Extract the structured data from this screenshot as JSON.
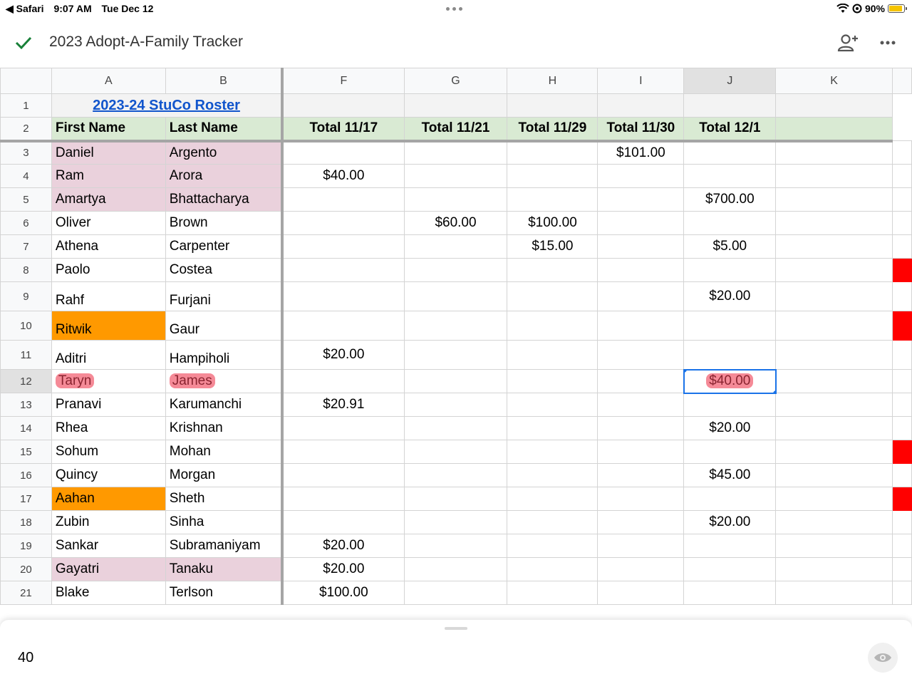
{
  "status_bar": {
    "back_app": "◀ Safari",
    "time": "9:07 AM",
    "date": "Tue Dec 12",
    "battery": "90%",
    "battery_level": 0.9
  },
  "header": {
    "title": "2023 Adopt-A-Family Tracker",
    "icons": [
      "check-icon",
      "add-person-icon",
      "more-icon"
    ]
  },
  "columns": [
    "A",
    "B",
    "F",
    "G",
    "H",
    "I",
    "J",
    "K"
  ],
  "title_row": {
    "row": "1",
    "text": "2023-24 StuCo Roster"
  },
  "header_row": {
    "row": "2",
    "cells": [
      "First Name",
      "Last Name",
      "Total 11/17",
      "Total 11/21",
      "Total 11/29",
      "Total 11/30",
      "Total 12/1",
      ""
    ]
  },
  "rows": [
    {
      "n": "3",
      "cells": [
        "Daniel",
        "Argento",
        "",
        "",
        "",
        "$101.00",
        "",
        ""
      ]
    },
    {
      "n": "4",
      "cells": [
        "Ram",
        "Arora",
        "$40.00",
        "",
        "",
        "",
        "",
        ""
      ]
    },
    {
      "n": "5",
      "cells": [
        "Amartya",
        "Bhattacharya",
        "",
        "",
        "",
        "",
        "$700.00",
        ""
      ]
    },
    {
      "n": "6",
      "cells": [
        "Oliver",
        "Brown",
        "",
        "$60.00",
        "$100.00",
        "",
        "",
        ""
      ]
    },
    {
      "n": "7",
      "cells": [
        "Athena",
        "Carpenter",
        "",
        "",
        "$15.00",
        "",
        "$5.00",
        ""
      ]
    },
    {
      "n": "8",
      "cells": [
        "Paolo",
        "Costea",
        "",
        "",
        "",
        "",
        "",
        ""
      ]
    },
    {
      "n": "9",
      "cells": [
        "Rahf",
        "Furjani",
        "",
        "",
        "",
        "",
        "$20.00",
        ""
      ]
    },
    {
      "n": "10",
      "cells": [
        "Ritwik",
        "Gaur",
        "",
        "",
        "",
        "",
        "",
        ""
      ]
    },
    {
      "n": "11",
      "cells": [
        "Aditri",
        "Hampiholi",
        "$20.00",
        "",
        "",
        "",
        "",
        ""
      ]
    },
    {
      "n": "12",
      "cells": [
        "Taryn",
        "James",
        "",
        "",
        "",
        "",
        "$40.00",
        ""
      ]
    },
    {
      "n": "13",
      "cells": [
        "Pranavi",
        "Karumanchi",
        "$20.91",
        "",
        "",
        "",
        "",
        ""
      ]
    },
    {
      "n": "14",
      "cells": [
        "Rhea",
        "Krishnan",
        "",
        "",
        "",
        "",
        "$20.00",
        ""
      ]
    },
    {
      "n": "15",
      "cells": [
        "Sohum",
        "Mohan",
        "",
        "",
        "",
        "",
        "",
        ""
      ]
    },
    {
      "n": "16",
      "cells": [
        "Quincy",
        "Morgan",
        "",
        "",
        "",
        "",
        "$45.00",
        ""
      ]
    },
    {
      "n": "17",
      "cells": [
        "Aahan",
        "Sheth",
        "",
        "",
        "",
        "",
        "",
        ""
      ]
    },
    {
      "n": "18",
      "cells": [
        "Zubin",
        "Sinha",
        "",
        "",
        "",
        "",
        "$20.00",
        ""
      ]
    },
    {
      "n": "19",
      "cells": [
        "Sankar",
        "Subramaniyam",
        "$20.00",
        "",
        "",
        "",
        "",
        ""
      ]
    },
    {
      "n": "20",
      "cells": [
        "Gayatri",
        "Tanaku",
        "$20.00",
        "",
        "",
        "",
        "",
        ""
      ]
    },
    {
      "n": "21",
      "cells": [
        "Blake",
        "Terlson",
        "$100.00",
        "",
        "",
        "",
        "",
        ""
      ]
    }
  ],
  "selected_cell": {
    "column": "J",
    "row": "12"
  },
  "formula_bar": {
    "value": "40"
  },
  "colors": {
    "pink": "#ead1dc",
    "orange": "#ff9900",
    "header_green": "#d9ead3",
    "red": "#ff0000",
    "selection": "#1a73e8",
    "link": "#1155cc"
  }
}
